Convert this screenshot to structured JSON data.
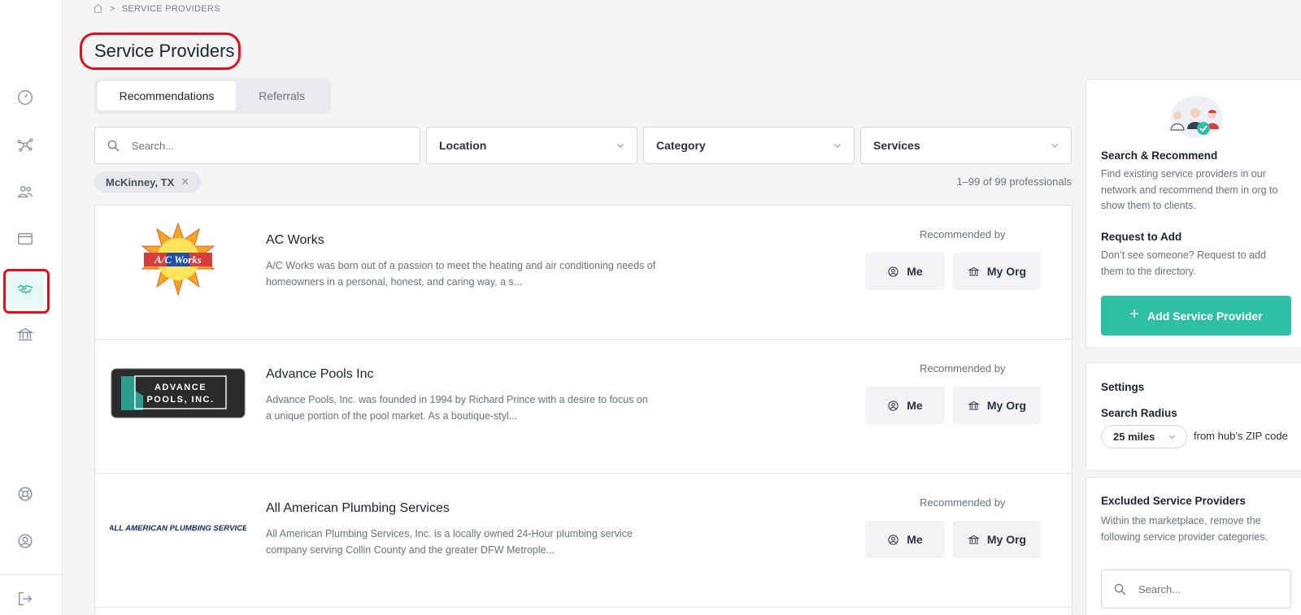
{
  "breadcrumb": {
    "current": "SERVICE PROVIDERS"
  },
  "page": {
    "title": "Service Providers"
  },
  "tabs": [
    {
      "label": "Recommendations",
      "active": true
    },
    {
      "label": "Referrals",
      "active": false
    }
  ],
  "filters": {
    "search_placeholder": "Search...",
    "location": "Location",
    "category": "Category",
    "services": "Services"
  },
  "active_filter": {
    "label": "McKinney, TX",
    "remove": "✕"
  },
  "results_count": "1–99 of 99 professionals",
  "providers": [
    {
      "name": "AC Works",
      "logo_text": "A/C Works",
      "description": "A/C Works was born out of a passion to meet the heating and air conditioning needs of homeowners in a personal, honest, and caring way, a s...",
      "recommended_label": "Recommended by",
      "me_label": "Me",
      "org_label": "My Org"
    },
    {
      "name": "Advance Pools Inc",
      "logo_text": "ADVANCE POOLS, INC.",
      "description": "Advance Pools, Inc. was founded in 1994 by Richard Prince with a desire to focus on a unique portion of the pool market. As a boutique-styl...",
      "recommended_label": "Recommended by",
      "me_label": "Me",
      "org_label": "My Org"
    },
    {
      "name": "All American Plumbing Services",
      "logo_text": "ALL AMERICAN PLUMBING SERVICE",
      "description": "All American Plumbing Services, Inc. is a locally owned 24-Hour plumbing service company serving Collin County and the greater DFW Metrople...",
      "recommended_label": "Recommended by",
      "me_label": "Me",
      "org_label": "My Org"
    }
  ],
  "side_panel": {
    "search_heading": "Search & Recommend",
    "search_text": "Find existing service providers in our network and recommend them in org to show them to clients.",
    "request_heading": "Request to Add",
    "request_text": "Don’t see someone? Request to add them to the directory.",
    "add_button": "Add Service Provider",
    "add_icon": "+",
    "settings_heading": "Settings",
    "radius_label": "Search Radius",
    "radius_value": "25 miles",
    "radius_note": "from hub’s ZIP code",
    "excluded_heading": "Excluded Service Providers",
    "excluded_text": "Within the marketplace, remove the following service provider categories.",
    "excluded_search_placeholder": "Search..."
  },
  "colors": {
    "accent": "#2fbfa3",
    "highlight": "#e0101e"
  },
  "icons": {
    "nav": [
      "dashboard-icon",
      "network-icon",
      "clients-icon",
      "browser-icon",
      "handshake-icon",
      "bank-icon",
      "support-icon",
      "account-icon",
      "logout-icon"
    ]
  }
}
